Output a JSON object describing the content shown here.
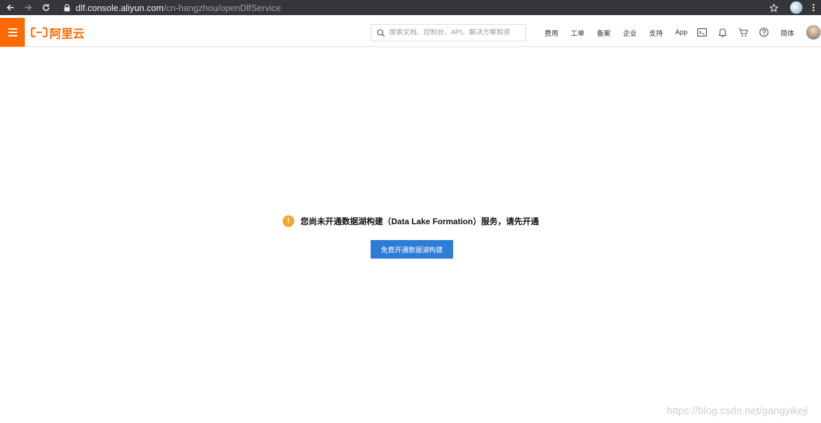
{
  "browser": {
    "url_host": "dlf.console.aliyun.com",
    "url_path": "/cn-hangzhou/openDlfService"
  },
  "header": {
    "logo_text": "阿里云",
    "search_placeholder": "搜索文档、控制台、API、解决方案和资",
    "links": [
      "费用",
      "工单",
      "备案",
      "企业",
      "支持",
      "App"
    ],
    "language": "简体",
    "icons": [
      "terminal-icon",
      "bell-icon",
      "cart-icon",
      "help-icon"
    ]
  },
  "main": {
    "notice": "您尚未开通数据湖构建（Data Lake Formation）服务，请先开通",
    "cta_label": "免费开通数据湖构建"
  },
  "watermark": "https://blog.csdn.net/gangyikeji",
  "colors": {
    "brand_orange": "#ff6a00",
    "primary_blue": "#2d7cd6",
    "warning": "#f5a623",
    "chrome_bar": "#35363a"
  }
}
